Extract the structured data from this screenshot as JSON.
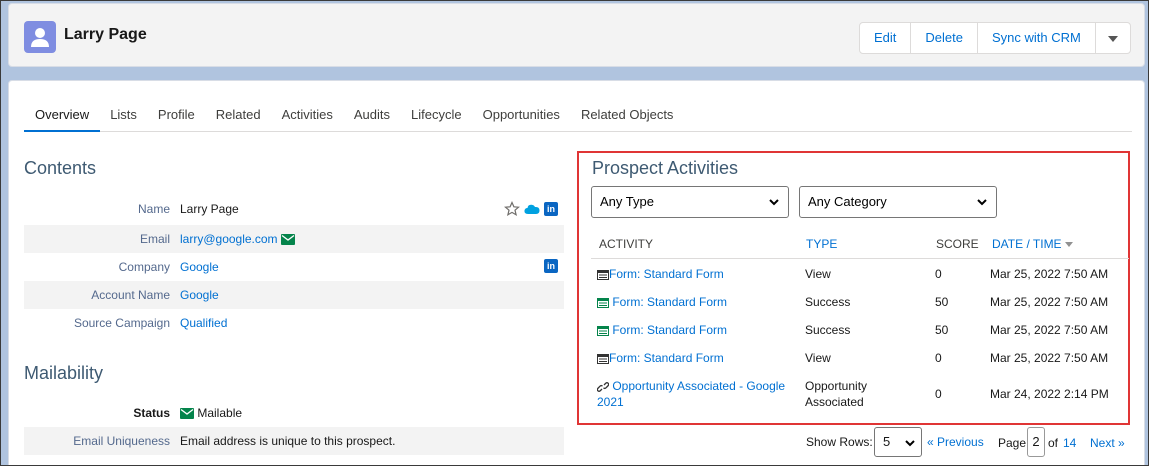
{
  "header": {
    "title": "Larry Page",
    "buttons": {
      "edit": "Edit",
      "delete": "Delete",
      "sync": "Sync with CRM"
    }
  },
  "tabs": [
    "Overview",
    "Lists",
    "Profile",
    "Related",
    "Activities",
    "Audits",
    "Lifecycle",
    "Opportunities",
    "Related Objects"
  ],
  "contents": {
    "title": "Contents",
    "fields": [
      {
        "label": "Name",
        "value": "Larry Page"
      },
      {
        "label": "Email",
        "value": "larry@google.com"
      },
      {
        "label": "Company",
        "value": "Google"
      },
      {
        "label": "Account Name",
        "value": "Google"
      },
      {
        "label": "Source Campaign",
        "value": "Qualified"
      }
    ],
    "icons": {
      "star": "star-icon",
      "salesforce": "salesforce-cloud-icon",
      "linkedin": "in"
    }
  },
  "mailability": {
    "title": "Mailability",
    "fields": [
      {
        "label": "Status",
        "value": "Mailable"
      },
      {
        "label": "Email Uniqueness",
        "value": "Email address is unique to this prospect."
      }
    ]
  },
  "activities": {
    "title": "Prospect Activities",
    "type_filter": "Any Type",
    "category_filter": "Any Category",
    "columns": {
      "activity": "ACTIVITY",
      "type": "TYPE",
      "score": "SCORE",
      "date": "DATE / TIME"
    },
    "rows": [
      {
        "activity": "Form: Standard Form",
        "type": "View",
        "score": "0",
        "date": "Mar 25, 2022 7:50 AM",
        "icon": "form-icon"
      },
      {
        "activity": "Form: Standard Form",
        "type": "Success",
        "score": "50",
        "date": "Mar 25, 2022 7:50 AM",
        "icon": "form-success-icon"
      },
      {
        "activity": "Form: Standard Form",
        "type": "Success",
        "score": "50",
        "date": "Mar 25, 2022 7:50 AM",
        "icon": "form-success-icon"
      },
      {
        "activity": "Form: Standard Form",
        "type": "View",
        "score": "0",
        "date": "Mar 25, 2022 7:50 AM",
        "icon": "form-icon"
      },
      {
        "activity_line1": "Opportunity Associated - Google",
        "activity_line2": "2021",
        "type_line1": "Opportunity",
        "type_line2": "Associated",
        "score": "0",
        "date": "Mar 24, 2022 2:14 PM",
        "icon": "link-icon"
      }
    ],
    "pager": {
      "show_rows_label": "Show Rows:",
      "rows_value": "5",
      "previous": "« Previous",
      "page_label": "Page",
      "page_value": "2",
      "of_label": "of",
      "total_pages": "14",
      "next": "Next »"
    }
  },
  "colors": {
    "accent": "#0070d2",
    "highlight_border": "#e03535",
    "success_green": "#04844b"
  }
}
